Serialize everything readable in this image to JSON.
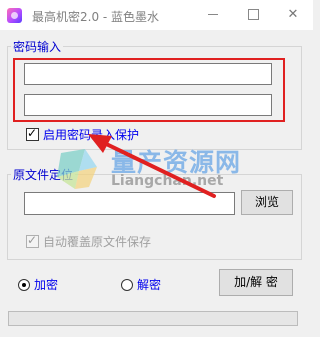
{
  "window": {
    "title": "最高机密2.0 - 蓝色墨水",
    "minimize_glyph": "",
    "maximize_glyph": "",
    "close_glyph": "✕"
  },
  "password_group": {
    "legend": "密码输入",
    "password_1": "",
    "password_2": "",
    "protect_checkbox_label": "启用密码录入保护",
    "protect_checked": true
  },
  "file_group": {
    "legend": "原文件定位",
    "file_path": "",
    "browse_label": "浏览",
    "overwrite_label": "自动覆盖原文件保存",
    "overwrite_checked": true,
    "overwrite_enabled": false
  },
  "mode": {
    "encrypt_label": "加密",
    "decrypt_label": "解密",
    "selected": "encrypt",
    "action_label": "加/解 密"
  },
  "progress": {
    "value": 0
  },
  "watermark": {
    "title": "量产资源网",
    "url": "Liangchan.net"
  },
  "colors": {
    "label_blue": "#0000ee",
    "highlight_red": "#e02020",
    "watermark_blue": "#8ab8e8"
  }
}
